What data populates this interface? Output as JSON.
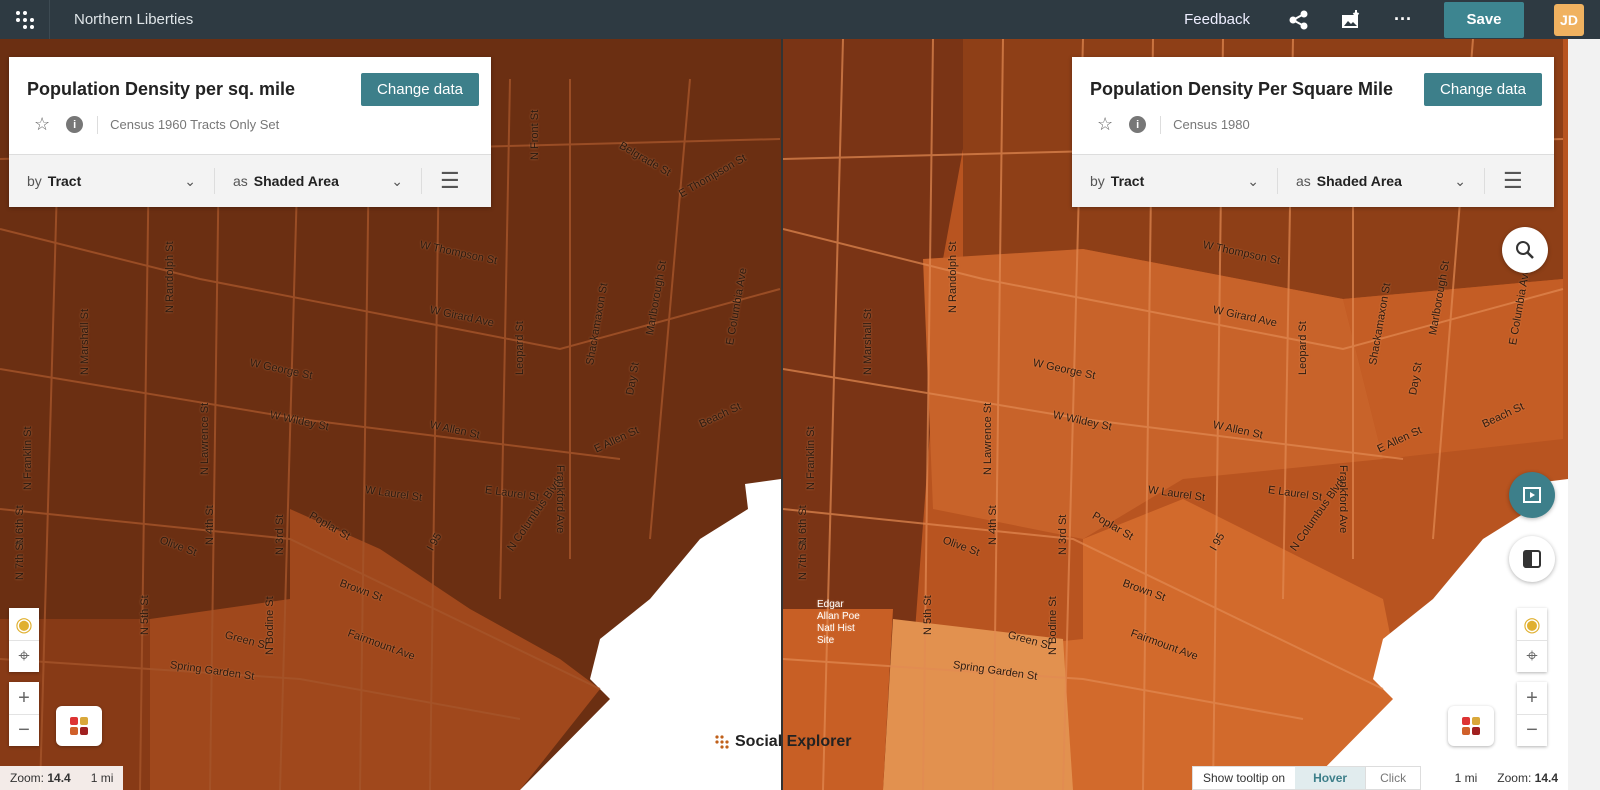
{
  "topbar": {
    "title": "Northern Liberties",
    "feedback": "Feedback",
    "save": "Save",
    "avatar": "JD",
    "icons": [
      "apps-icon",
      "share-icon",
      "export-image-icon",
      "more-icon"
    ]
  },
  "left_panel": {
    "title": "Population Density per sq. mile",
    "change_data": "Change data",
    "dataset": "Census 1960 Tracts Only Set",
    "by_prefix": "by",
    "by_value": "Tract",
    "as_prefix": "as",
    "as_value": "Shaded Area"
  },
  "right_panel": {
    "title": "Population Density Per Square Mile",
    "change_data": "Change data",
    "dataset": "Census 1980",
    "by_prefix": "by",
    "by_value": "Tract",
    "as_prefix": "as",
    "as_value": "Shaded Area"
  },
  "left_status": {
    "zoom_label": "Zoom:",
    "zoom_value": "14.4",
    "scale": "1 mi"
  },
  "right_status": {
    "zoom_label": "Zoom:",
    "zoom_value": "14.4",
    "scale": "1 mi"
  },
  "tooltip": {
    "label": "Show tooltip on",
    "hover": "Hover",
    "click": "Click"
  },
  "logo": "Social Explorer",
  "poi": "Edgar Allan Poe Natl Hist Site",
  "streets": [
    "W Thompson St",
    "W Girard Ave",
    "W George St",
    "W Wildey St",
    "W Allen St",
    "W Laurel St",
    "E Laurel St",
    "Poplar St",
    "Brown St",
    "Fairmount Ave",
    "Spring Garden St",
    "Green St",
    "N Columbus Blvd",
    "Frankford Ave",
    "Beach St",
    "E Allen St",
    "N Randolph St",
    "N Marshall St",
    "N Franklin St",
    "N Lawrence St",
    "N 4th St",
    "N 3rd St",
    "N 6th St",
    "N 7th St",
    "N 5th St",
    "N Bodine St",
    "I 95",
    "Olive St",
    "Leopard St",
    "Shackamaxon St",
    "Day St",
    "Marlborough St",
    "E Columbia Ave",
    "Belgrade St",
    "E Thompson St",
    "N Front St"
  ],
  "colors": {
    "accent": "#3d7f8a",
    "topbar": "#2e3a42",
    "dark": "#6b2f12",
    "mid": "#9a4519",
    "light": "#d26a2c",
    "lighter": "#e2914f"
  }
}
